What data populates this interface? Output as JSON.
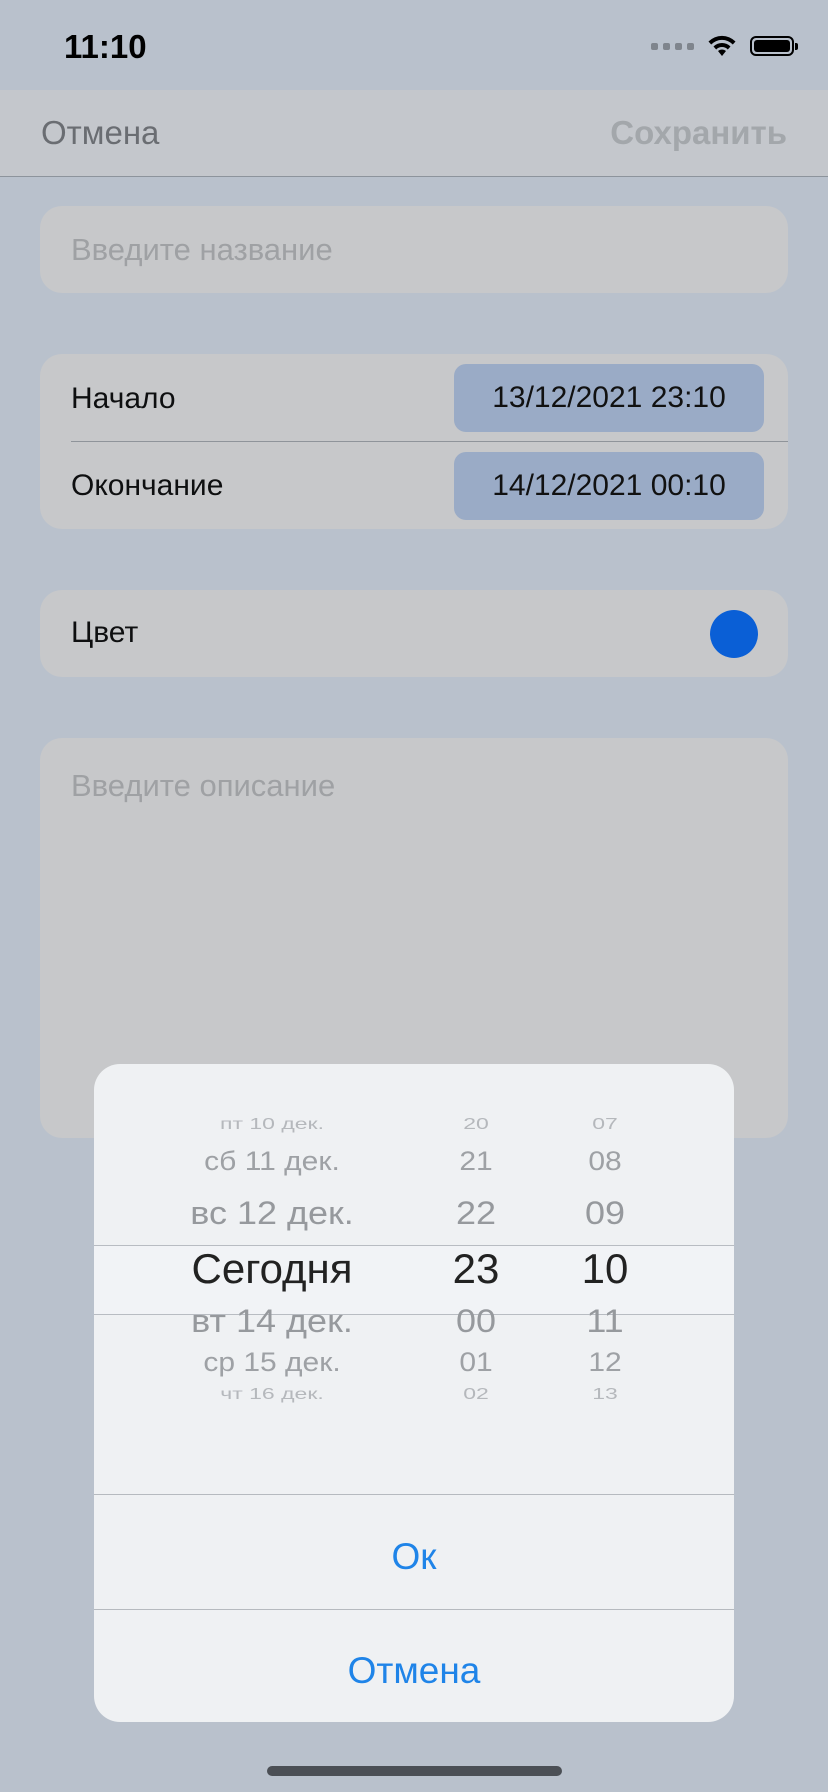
{
  "status_bar": {
    "time": "11:10"
  },
  "nav": {
    "cancel_label": "Отмена",
    "save_label": "Сохранить"
  },
  "form": {
    "name_placeholder": "Введите название",
    "start_label": "Начало",
    "start_value": "13/12/2021 23:10",
    "end_label": "Окончание",
    "end_value": "14/12/2021 00:10",
    "color_label": "Цвет",
    "color_value": "#0a5fd6",
    "description_placeholder": "Введите описание"
  },
  "picker": {
    "days": [
      "пт 10 дек.",
      "сб 11 дек.",
      "вс 12 дек.",
      "Сегодня",
      "вт 14 дек.",
      "ср 15 дек.",
      "чт 16 дек."
    ],
    "hours": [
      "20",
      "21",
      "22",
      "23",
      "00",
      "01",
      "02"
    ],
    "minutes": [
      "07",
      "08",
      "09",
      "10",
      "11",
      "12",
      "13"
    ],
    "ok_label": "Ок",
    "cancel_label": "Отмена"
  }
}
